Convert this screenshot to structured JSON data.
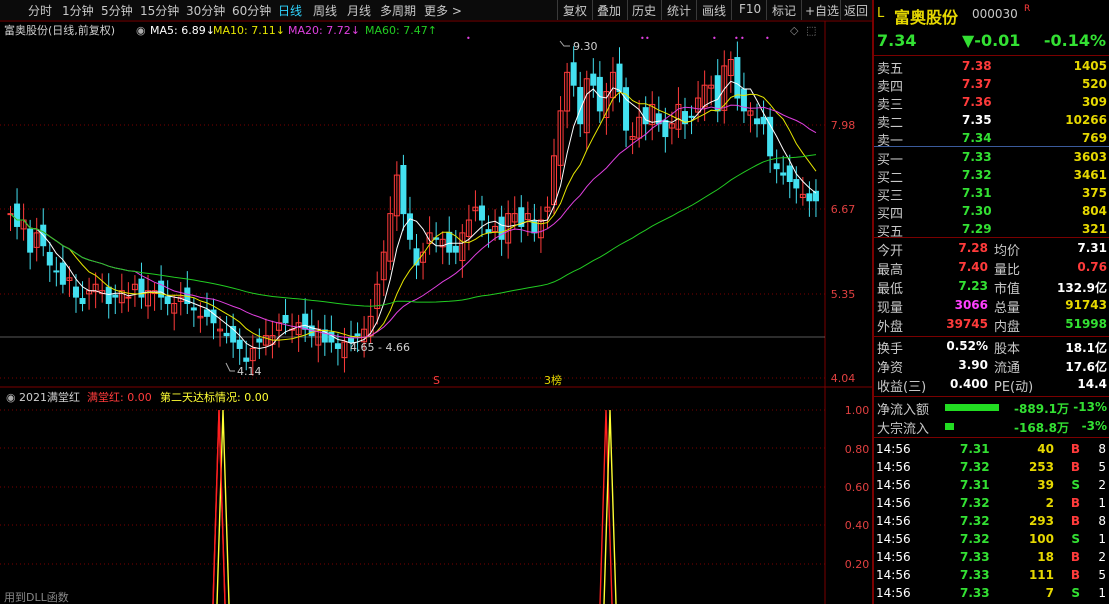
{
  "toolbar": {
    "periods": [
      "分时",
      "1分钟",
      "5分钟",
      "15分钟",
      "30分钟",
      "60分钟",
      "日线",
      "周线",
      "月线",
      "多周期",
      "更多 >"
    ],
    "active_period": "日线",
    "buttons": [
      "复权",
      "叠加",
      "历史",
      "统计",
      "画线",
      "F10",
      "标记",
      "+自选",
      "返回"
    ]
  },
  "chart_header": {
    "name": "富奥股份(日线,前复权)",
    "ma5": "MA5: 6.89↓",
    "ma10": "MA10: 7.11↓",
    "ma20": "MA20: 7.72↓",
    "ma60": "MA60: 7.47↑"
  },
  "price_axis": [
    "7.98",
    "6.67",
    "5.35",
    "4.04"
  ],
  "annotations": {
    "high": "9.30",
    "low": "4.14",
    "range": "4.65 - 4.66",
    "marker_s": "S",
    "marker_rank": "3榜"
  },
  "indicator": {
    "name": "2021满堂红",
    "value1": "满堂红: 0.00",
    "value2": "第二天达标情况: 0.00",
    "axis": [
      "1.00",
      "0.80",
      "0.60",
      "0.40",
      "0.20"
    ],
    "footer": "用到DLL函数"
  },
  "colors": {
    "up": "#ff3b3b",
    "down": "#43e0f0",
    "ma5": "#ffffff",
    "ma10": "#e6e600",
    "ma20": "#e040e0",
    "ma60": "#22cc22",
    "grid": "#7a0000"
  },
  "quote": {
    "marker": "L",
    "name": "富奥股份",
    "code": "000030",
    "r_tag": "R",
    "price": "7.34",
    "change": "▼-0.01",
    "pct": "-0.14%",
    "asks": [
      {
        "label": "卖五",
        "price": "7.38",
        "vol": "1405"
      },
      {
        "label": "卖四",
        "price": "7.37",
        "vol": "520"
      },
      {
        "label": "卖三",
        "price": "7.36",
        "vol": "309"
      },
      {
        "label": "卖二",
        "price": "7.35",
        "vol": "10266"
      },
      {
        "label": "卖一",
        "price": "7.34",
        "vol": "769"
      }
    ],
    "bids": [
      {
        "label": "买一",
        "price": "7.33",
        "vol": "3603"
      },
      {
        "label": "买二",
        "price": "7.32",
        "vol": "3461"
      },
      {
        "label": "买三",
        "price": "7.31",
        "vol": "375"
      },
      {
        "label": "买四",
        "price": "7.30",
        "vol": "804"
      },
      {
        "label": "买五",
        "price": "7.29",
        "vol": "321"
      }
    ],
    "stats": [
      {
        "l1": "今开",
        "v1": "7.28",
        "l2": "均价",
        "v2": "7.31"
      },
      {
        "l1": "最高",
        "v1": "7.40",
        "l2": "量比",
        "v2": "0.76"
      },
      {
        "l1": "最低",
        "v1": "7.23",
        "l2": "市值",
        "v2": "132.9亿"
      },
      {
        "l1": "现量",
        "v1": "3066",
        "l2": "总量",
        "v2": "91743"
      },
      {
        "l1": "外盘",
        "v1": "39745",
        "l2": "内盘",
        "v2": "51998"
      }
    ],
    "info": [
      {
        "l1": "换手",
        "v1": "0.52%",
        "l2": "股本",
        "v2": "18.1亿"
      },
      {
        "l1": "净资",
        "v1": "3.90",
        "l2": "流通",
        "v2": "17.6亿"
      },
      {
        "l1": "收益(三)",
        "v1": "0.400",
        "l2": "PE(动)",
        "v2": "14.4"
      }
    ],
    "flows": [
      {
        "label": "净流入额",
        "value": "-889.1万",
        "pct": "-13%",
        "bar": 0.6
      },
      {
        "label": "大宗流入",
        "value": "-168.8万",
        "pct": "-3%",
        "bar": 0.1
      }
    ],
    "ticks": [
      {
        "t": "14:56",
        "p": "7.31",
        "v": "40",
        "d": "B",
        "n": "8"
      },
      {
        "t": "14:56",
        "p": "7.32",
        "v": "253",
        "d": "B",
        "n": "5"
      },
      {
        "t": "14:56",
        "p": "7.31",
        "v": "39",
        "d": "S",
        "n": "2"
      },
      {
        "t": "14:56",
        "p": "7.32",
        "v": "2",
        "d": "B",
        "n": "1"
      },
      {
        "t": "14:56",
        "p": "7.32",
        "v": "293",
        "d": "B",
        "n": "8"
      },
      {
        "t": "14:56",
        "p": "7.32",
        "v": "100",
        "d": "S",
        "n": "1"
      },
      {
        "t": "14:56",
        "p": "7.33",
        "v": "18",
        "d": "B",
        "n": "2"
      },
      {
        "t": "14:56",
        "p": "7.33",
        "v": "111",
        "d": "B",
        "n": "5"
      },
      {
        "t": "14:56",
        "p": "7.33",
        "v": "7",
        "d": "S",
        "n": "1"
      }
    ]
  }
}
